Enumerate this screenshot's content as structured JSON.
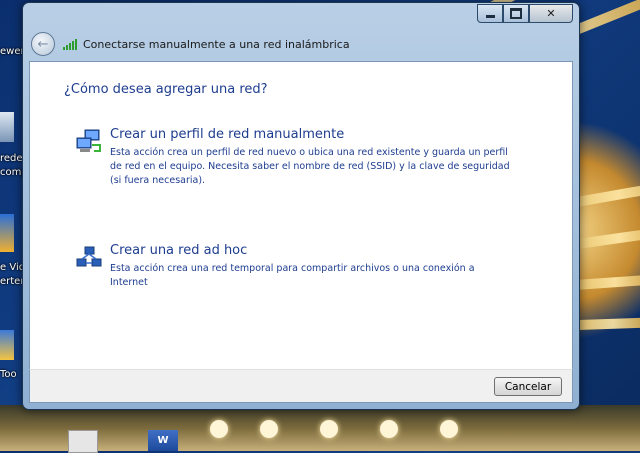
{
  "window": {
    "title": "Conectarse manualmente a una red inalámbrica",
    "heading": "¿Cómo desea agregar una red?"
  },
  "options": [
    {
      "title": "Crear un perfil de red manualmente",
      "description": "Esta acción crea un perfil de red nuevo o ubica una red existente y guarda un perfil de red en el equipo. Necesita saber el nombre de red (SSID) y la clave de seguridad (si fuera necesaria).",
      "icon": "network-computers-icon"
    },
    {
      "title": "Crear una red ad hoc",
      "description": "Esta acción crea una red temporal para compartir archivos o una conexión a Internet",
      "icon": "adhoc-network-icon"
    }
  ],
  "footer": {
    "cancel_label": "Cancelar"
  },
  "desktop": {
    "labels": [
      "ewer",
      "rede",
      "comp",
      "e Vid",
      "erter",
      "Too"
    ]
  },
  "colors": {
    "link_blue": "#1e3d8f",
    "frame_blue": "#8fb0d2"
  }
}
